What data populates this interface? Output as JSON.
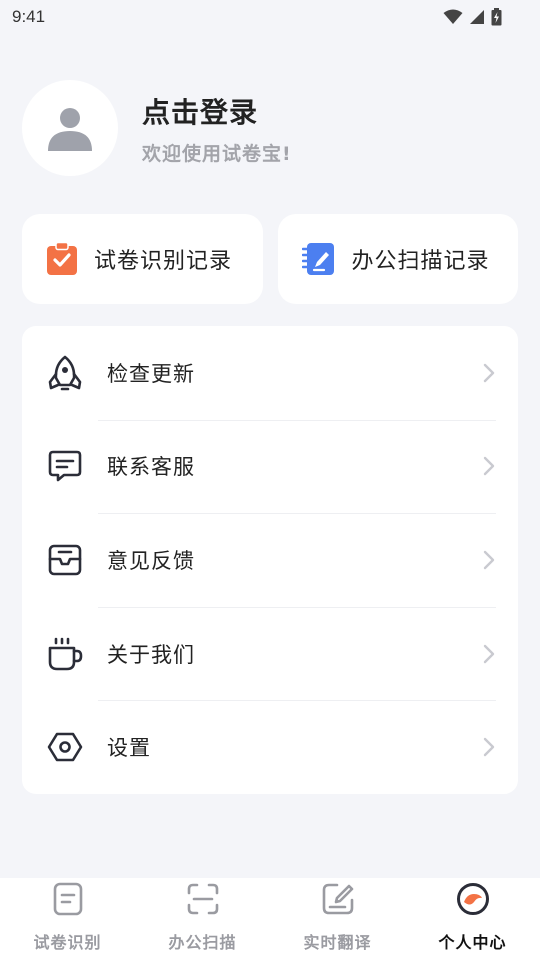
{
  "status_bar": {
    "time": "9:41"
  },
  "profile": {
    "login_title": "点击登录",
    "welcome": "欢迎使用试卷宝!"
  },
  "quick_cards": [
    {
      "label": "试卷识别记录",
      "icon": "clipboard-check-icon",
      "color": "#f37245"
    },
    {
      "label": "办公扫描记录",
      "icon": "notebook-pen-icon",
      "color": "#4c7ff0"
    }
  ],
  "menu": {
    "items": [
      {
        "label": "检查更新",
        "icon": "rocket-icon"
      },
      {
        "label": "联系客服",
        "icon": "message-icon"
      },
      {
        "label": "意见反馈",
        "icon": "mailbox-icon"
      },
      {
        "label": "关于我们",
        "icon": "coffee-cup-icon"
      },
      {
        "label": "设置",
        "icon": "hexagon-settings-icon"
      }
    ]
  },
  "bottom_nav": {
    "items": [
      {
        "label": "试卷识别",
        "icon": "document-icon",
        "active": false
      },
      {
        "label": "办公扫描",
        "icon": "scan-icon",
        "active": false
      },
      {
        "label": "实时翻译",
        "icon": "edit-square-icon",
        "active": false
      },
      {
        "label": "个人中心",
        "icon": "profile-circle-icon",
        "active": true
      }
    ]
  },
  "colors": {
    "background": "#f4f5f9",
    "card": "#ffffff",
    "primary_text": "#222222",
    "secondary_text": "#a3a4aa",
    "icon_stroke": "#2b2d38",
    "accent_orange": "#f37245",
    "accent_blue": "#4c7ff0"
  }
}
